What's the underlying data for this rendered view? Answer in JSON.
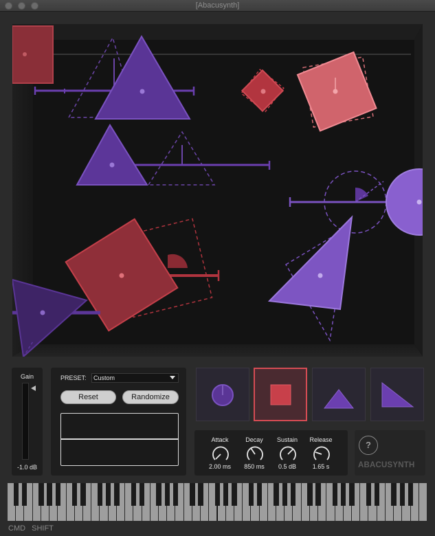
{
  "window": {
    "title": "[Abacusynth]"
  },
  "gain": {
    "label": "Gain",
    "value": "-1.0 dB",
    "level": 0.93
  },
  "preset": {
    "label": "PRESET:",
    "selected": "Custom",
    "reset_label": "Reset",
    "randomize_label": "Randomize"
  },
  "shapes": {
    "items": [
      "circle",
      "square",
      "triangle",
      "right-triangle"
    ],
    "selected": "square"
  },
  "envelope": {
    "attack": {
      "label": "Attack",
      "value": "2.00 ms"
    },
    "decay": {
      "label": "Decay",
      "value": "850 ms"
    },
    "sustain": {
      "label": "Sustain",
      "value": "0.5 dB"
    },
    "release": {
      "label": "Release",
      "value": "1.65 s"
    }
  },
  "help": {
    "label": "?"
  },
  "logo": {
    "text": "ABACUSYNTH"
  },
  "modifiers": {
    "cmd": "CMD",
    "shift": "SHIFT"
  },
  "colors": {
    "purple": "#7f4dc6",
    "red": "#c8404a",
    "salmon": "#e0727a",
    "background": "#2b2b2b"
  }
}
